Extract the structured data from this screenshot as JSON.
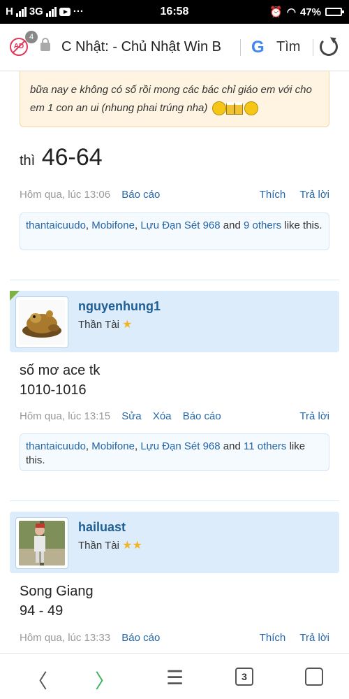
{
  "status_bar": {
    "carrier_left": "H",
    "network": "3G",
    "menu_dots": "···",
    "time": "16:58",
    "battery": "47%"
  },
  "browser": {
    "adblock_count": "4",
    "url_text": "C Nhật: - Chủ Nhật Win B",
    "google_letter": "G",
    "search_label": "Tìm",
    "tabs_count": "3"
  },
  "posts": [
    {
      "quote_text": "bữa nay e không có số rồi mong các bác chỉ giáo em với cho em 1 con an ui (nhung phai trúng nha)",
      "message_prefix": "thì",
      "message_main": "46-64",
      "timestamp": "Hôm qua, lúc 13:06",
      "actions_left": [
        "Báo cáo"
      ],
      "actions_right": [
        "Thích",
        "Trả lời"
      ],
      "likes": {
        "names": [
          "thantaicuudo",
          "Mobifone",
          "Lựu Đạn Sét 968"
        ],
        "and": "and",
        "others": "9 others",
        "tail": "like this."
      }
    },
    {
      "username": "nguyenhung1",
      "user_title": "Thần Tài",
      "stars": "★",
      "message_lines": [
        "số mơ ace tk",
        "1010-1016"
      ],
      "timestamp": "Hôm qua, lúc 13:15",
      "actions_left": [
        "Sửa",
        "Xóa",
        "Báo cáo"
      ],
      "actions_right": [
        "Trả lời"
      ],
      "likes": {
        "names": [
          "thantaicuudo",
          "Mobifone",
          "Lựu Đạn Sét 968"
        ],
        "and": "and",
        "others": "11 others",
        "tail": "like this."
      }
    },
    {
      "username": "hailuast",
      "user_title": "Thần Tài",
      "stars": "★★",
      "message_lines": [
        "Song Giang",
        "94 - 49"
      ],
      "timestamp": "Hôm qua, lúc 13:33",
      "actions_left": [
        "Báo cáo"
      ],
      "actions_right": [
        "Thích",
        "Trả lời"
      ]
    }
  ],
  "bottom_nav": {
    "back": "〈",
    "forward": "〉",
    "menu": "☰"
  },
  "colors": {
    "link": "#2466a7",
    "user_bar": "#dcecfb",
    "quote_bg": "#fff4e1"
  }
}
